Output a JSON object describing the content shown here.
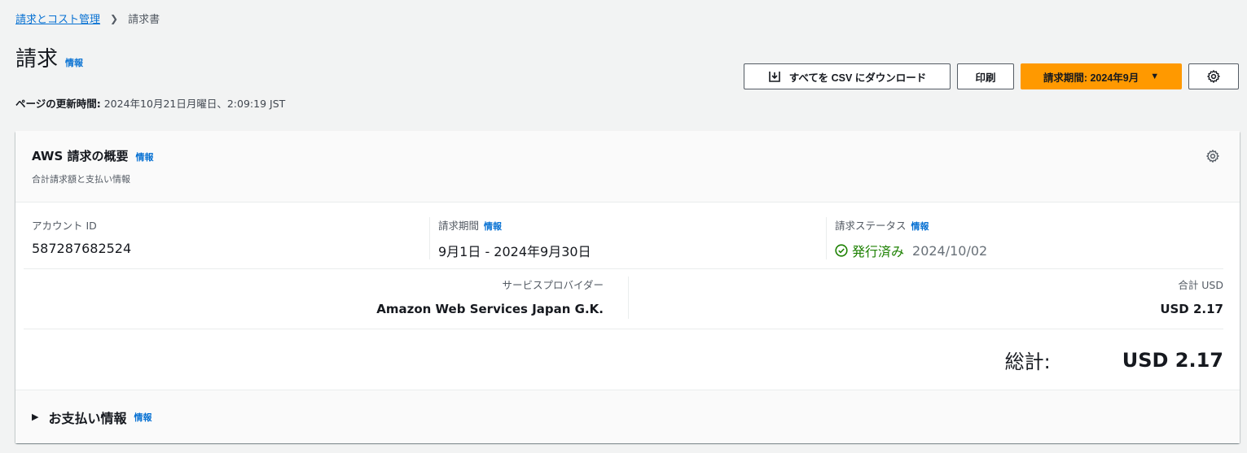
{
  "breadcrumb": {
    "parent": "請求とコスト管理",
    "current": "請求書"
  },
  "page": {
    "title": "請求",
    "info": "情報"
  },
  "updated": {
    "label": "ページの更新時間:",
    "value": "2024年10月21日月曜日、2:09:19 JST"
  },
  "actions": {
    "download": "すべてを CSV にダウンロード",
    "print": "印刷",
    "period": "請求期間: 2024年9月"
  },
  "summary": {
    "title": "AWS 請求の概要",
    "info": "情報",
    "subtitle": "合計請求額と支払い情報",
    "account_label": "アカウント ID",
    "account_value": "587287682524",
    "period_label": "請求期間",
    "period_info": "情報",
    "period_value": "9月1日 - 2024年9月30日",
    "status_label": "請求ステータス",
    "status_info": "情報",
    "status_value": "発行済み",
    "status_date": "2024/10/02",
    "provider_label": "サービスプロバイダー",
    "provider_value": "Amazon Web Services Japan G.K.",
    "total_usd_label": "合計 USD",
    "total_usd_value": "USD 2.17",
    "grand_label": "総計:",
    "grand_value": "USD 2.17"
  },
  "payment": {
    "title": "お支払い情報",
    "info": "情報"
  },
  "colors": {
    "accent": "#ff9900",
    "link": "#0972d3",
    "success": "#1d8102"
  }
}
